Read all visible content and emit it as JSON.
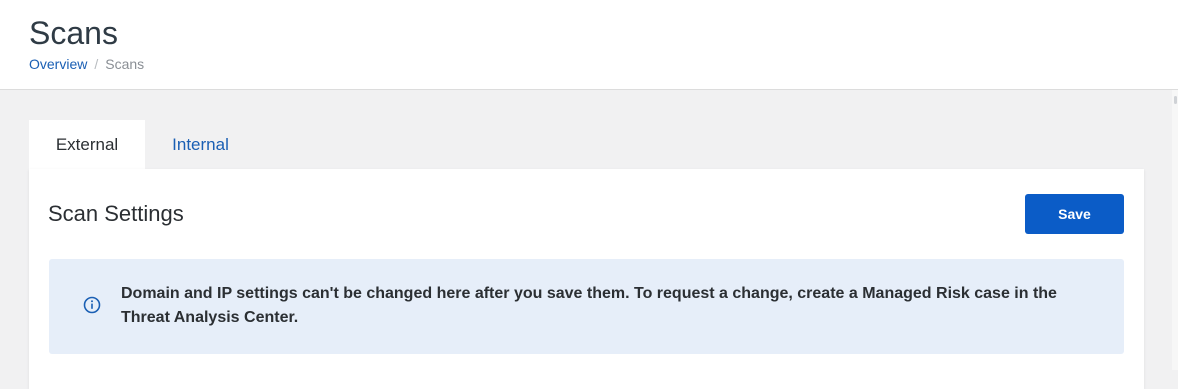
{
  "header": {
    "title": "Scans",
    "breadcrumb": {
      "items": [
        "Overview",
        "Scans"
      ],
      "separator": "/"
    }
  },
  "tabs": [
    {
      "label": "External",
      "active": true
    },
    {
      "label": "Internal",
      "active": false
    }
  ],
  "card": {
    "title": "Scan Settings",
    "save_label": "Save",
    "info": {
      "icon": "info-circle-icon",
      "text": "Domain and IP settings can't be changed here after you save them. To request a change, create a Managed Risk case in the Threat Analysis Center."
    }
  },
  "colors": {
    "accent": "#0b5cc7",
    "link": "#1a5fb4",
    "info_bg": "#e6eef9"
  }
}
